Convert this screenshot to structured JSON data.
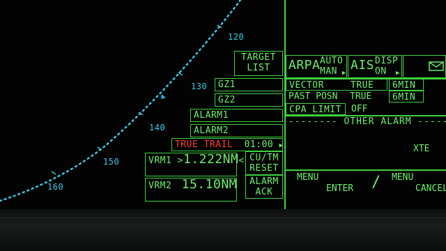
{
  "colors": {
    "phosphor": "#5ee35e",
    "range_ring": "#3ec9e6",
    "alert": "#ff3b2a"
  },
  "range_labels": [
    "120",
    "130",
    "140",
    "150",
    "160"
  ],
  "left_panel": {
    "target_list": [
      "TARGET",
      "LIST"
    ],
    "gz1": "GZ1",
    "gz2": "GZ2",
    "alarm1": "ALARM1",
    "alarm2": "ALARM2",
    "true_trail": "TRUE TRAIL",
    "trail_time": "01:00",
    "vrm1_label": "VRM1",
    "vrm1_value": "1.222NM",
    "vrm2_label": "VRM2",
    "vrm2_value": "15.10NM",
    "cu_tm": "CU/TM",
    "reset": "RESET",
    "alarm": "ALARM",
    "ack": "ACK"
  },
  "right_panel": {
    "arpa": "ARPA",
    "arpa_mode": [
      "AUTO",
      "MAN"
    ],
    "ais": "AIS",
    "ais_disp": [
      "DISP",
      "ON"
    ],
    "mail_icon": "envelope-icon",
    "vector_label": "VECTOR",
    "vector_value": "TRUE",
    "vector_time": "6MIN",
    "past_posn_label": "PAST POSN",
    "past_posn_value": "TRUE",
    "past_posn_time": "6MIN",
    "cpa_limit_label": "CPA LIMIT",
    "cpa_limit_value": "OFF",
    "other_alarm": "OTHER ALARM",
    "xte": "XTE",
    "menu_left": "MENU",
    "enter": "ENTER",
    "menu_right": "MENU",
    "cancel": "CANCEL"
  }
}
